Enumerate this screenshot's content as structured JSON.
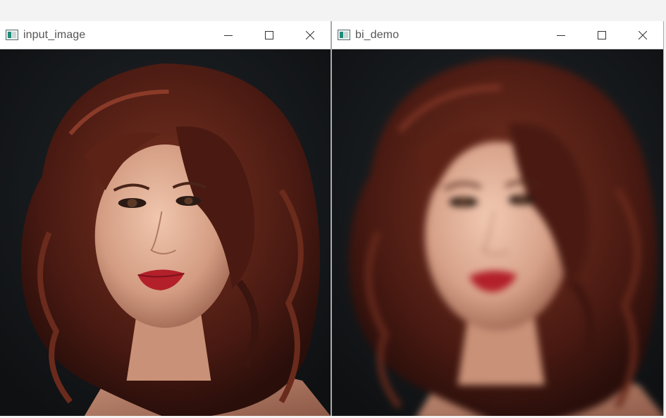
{
  "windows": [
    {
      "title": "input_image",
      "icon": "opencv-window-icon",
      "controls": [
        "minimize-icon",
        "maximize-icon",
        "close-icon"
      ]
    },
    {
      "title": "bi_demo",
      "icon": "opencv-window-icon",
      "controls": [
        "minimize-icon",
        "maximize-icon",
        "close-icon"
      ]
    }
  ],
  "colors": {
    "background": "#141618",
    "hair": "#5a2418",
    "skin": "#d9a48c",
    "lips": "#b3202a",
    "titlebar": "#ffffff"
  }
}
